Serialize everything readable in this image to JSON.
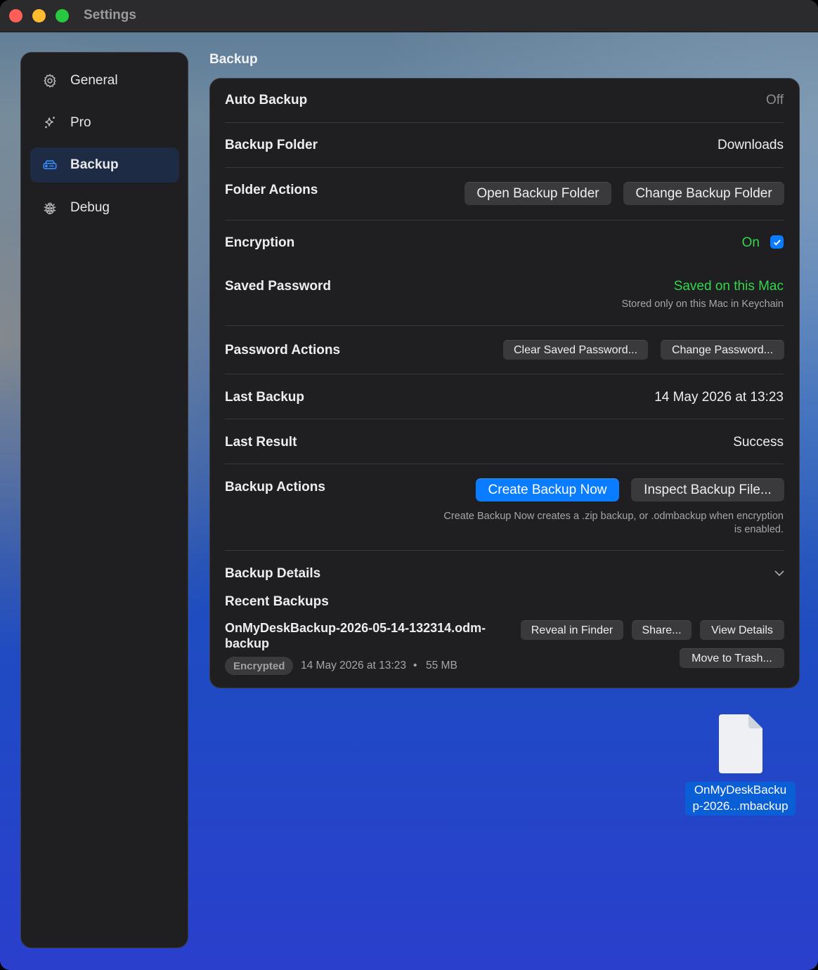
{
  "window": {
    "title": "Settings"
  },
  "sidebar": {
    "items": [
      {
        "label": "General",
        "icon": "gear-icon"
      },
      {
        "label": "Pro",
        "icon": "sparkles-icon"
      },
      {
        "label": "Backup",
        "icon": "drive-icon",
        "active": true
      },
      {
        "label": "Debug",
        "icon": "ladybug-icon"
      }
    ]
  },
  "section": {
    "title": "Backup"
  },
  "rows": {
    "auto_backup": {
      "label": "Auto Backup",
      "value": "Off"
    },
    "backup_folder": {
      "label": "Backup Folder",
      "value": "Downloads"
    },
    "folder_actions": {
      "label": "Folder Actions",
      "open_button": "Open Backup Folder",
      "change_button": "Change Backup Folder"
    },
    "encryption": {
      "label": "Encryption",
      "value": "On",
      "checked": true
    },
    "saved_password": {
      "label": "Saved Password",
      "value": "Saved on this Mac",
      "note": "Stored only on this Mac in Keychain"
    },
    "password_actions": {
      "label": "Password Actions",
      "clear_button": "Clear Saved Password...",
      "change_button": "Change Password..."
    },
    "last_backup": {
      "label": "Last Backup",
      "value": "14 May 2026 at 13:23"
    },
    "last_result": {
      "label": "Last Result",
      "value": "Success"
    },
    "backup_actions": {
      "label": "Backup Actions",
      "create_button": "Create Backup Now",
      "inspect_button": "Inspect Backup File...",
      "note_line1": "Create Backup Now creates a .zip backup, or .odmbackup when encryption",
      "note_line2": "is enabled."
    },
    "backup_details": {
      "label": "Backup Details",
      "recent_label": "Recent Backups"
    }
  },
  "recent_backup": {
    "name_line1": "OnMyDeskBackup-2026-05-14-132314.odm-",
    "name_line2": "backup",
    "badge": "Encrypted",
    "date": "14 May 2026 at 13:23",
    "separator": "•",
    "size": "55 MB",
    "reveal_button": "Reveal in Finder",
    "share_button": "Share...",
    "view_button": "View Details",
    "trash_button": "Move to Trash..."
  },
  "desktop_file": {
    "line1": "OnMyDeskBacku",
    "line2": "p-2026...mbackup"
  },
  "colors": {
    "accent": "#0a7cff",
    "success": "#32d74b",
    "panel": "#1f1f21"
  }
}
